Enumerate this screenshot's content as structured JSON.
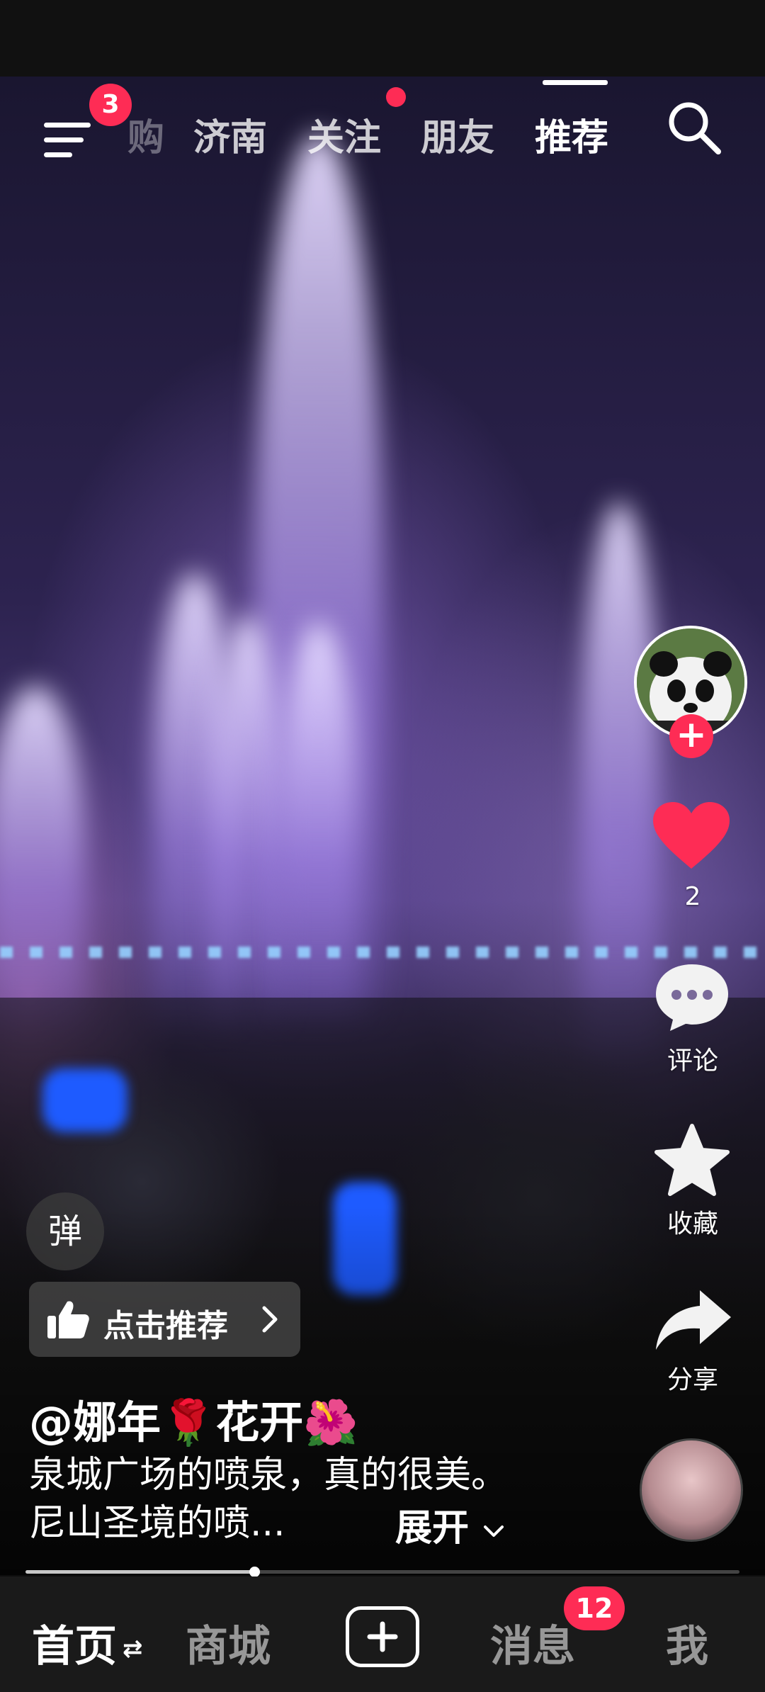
{
  "topnav": {
    "menu_badge": "3",
    "tabs": [
      {
        "label": "购"
      },
      {
        "label": "济南"
      },
      {
        "label": "关注"
      },
      {
        "label": "朋友"
      },
      {
        "label": "推荐"
      }
    ],
    "active_tab": "推荐"
  },
  "side_actions": {
    "follow_symbol": "+",
    "like_count": "2",
    "comment_label": "评论",
    "favorite_label": "收藏",
    "share_label": "分享"
  },
  "overlay": {
    "danmu_label": "弹",
    "recommend_label": "点击推荐",
    "author": "@娜年🌹花开🌺",
    "caption": "泉城广场的喷泉，真的很美。尼山圣境的喷...",
    "expand_label": "展开"
  },
  "progress": {
    "played_fraction": 0.32
  },
  "bottomnav": {
    "home": "首页",
    "home_switch_icon": "⇄",
    "mall": "商城",
    "messages": "消息",
    "messages_badge": "12",
    "me": "我"
  },
  "colors": {
    "accent": "#fe2c55",
    "nav_bg": "#1a1a1a"
  }
}
